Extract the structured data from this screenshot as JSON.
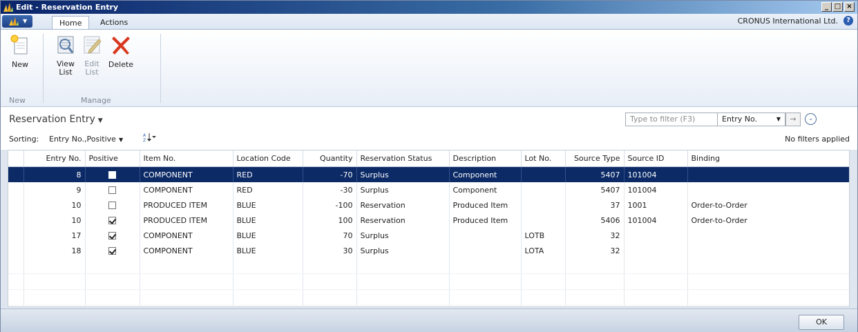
{
  "window": {
    "title": "Edit - Reservation Entry",
    "min": "_",
    "max": "□",
    "close": "×"
  },
  "tabs": {
    "home": "Home",
    "actions": "Actions"
  },
  "company": "CRONUS International Ltd.",
  "help_icon": "?",
  "ribbon": {
    "new_label": "New",
    "view_list_label": "View\nList",
    "edit_list_label": "Edit\nList",
    "delete_label": "Delete",
    "group_new": "New",
    "group_manage": "Manage"
  },
  "page": {
    "title": "Reservation Entry",
    "filter_placeholder": "Type to filter (F3)",
    "filter_field": "Entry No.",
    "go_arrow": "→",
    "sorting_label": "Sorting:",
    "sorting_value": "Entry No.,Positive",
    "filter_status": "No filters applied"
  },
  "columns": [
    "Entry No.",
    "Positive",
    "Item No.",
    "Location Code",
    "Quantity",
    "Reservation Status",
    "Description",
    "Lot No.",
    "Source Type",
    "Source ID",
    "Binding"
  ],
  "rows": [
    {
      "entry_no": "8",
      "positive": false,
      "item_no": "COMPONENT",
      "location": "RED",
      "quantity": "-70",
      "status": "Surplus",
      "description": "Component",
      "lot_no": "",
      "source_type": "5407",
      "source_id": "101004",
      "binding": "",
      "selected": true
    },
    {
      "entry_no": "9",
      "positive": false,
      "item_no": "COMPONENT",
      "location": "RED",
      "quantity": "-30",
      "status": "Surplus",
      "description": "Component",
      "lot_no": "",
      "source_type": "5407",
      "source_id": "101004",
      "binding": ""
    },
    {
      "entry_no": "10",
      "positive": false,
      "item_no": "PRODUCED ITEM",
      "location": "BLUE",
      "quantity": "-100",
      "status": "Reservation",
      "description": "Produced Item",
      "lot_no": "",
      "source_type": "37",
      "source_id": "1001",
      "binding": "Order-to-Order"
    },
    {
      "entry_no": "10",
      "positive": true,
      "item_no": "PRODUCED ITEM",
      "location": "BLUE",
      "quantity": "100",
      "status": "Reservation",
      "description": "Produced Item",
      "lot_no": "",
      "source_type": "5406",
      "source_id": "101004",
      "binding": "Order-to-Order"
    },
    {
      "entry_no": "17",
      "positive": true,
      "item_no": "COMPONENT",
      "location": "BLUE",
      "quantity": "70",
      "status": "Surplus",
      "description": "",
      "lot_no": "LOTB",
      "source_type": "32",
      "source_id": "",
      "binding": ""
    },
    {
      "entry_no": "18",
      "positive": true,
      "item_no": "COMPONENT",
      "location": "BLUE",
      "quantity": "30",
      "status": "Surplus",
      "description": "",
      "lot_no": "LOTA",
      "source_type": "32",
      "source_id": "",
      "binding": ""
    }
  ],
  "ok_label": "OK",
  "colors": {
    "selection": "#0b2a66",
    "title_bar": "#0a246a",
    "delete_icon": "#d9381e"
  },
  "icons": [
    "app-logo-icon",
    "new-document-icon",
    "view-list-icon",
    "edit-list-icon",
    "delete-icon",
    "help-icon",
    "expand-icon",
    "sort-icon"
  ]
}
